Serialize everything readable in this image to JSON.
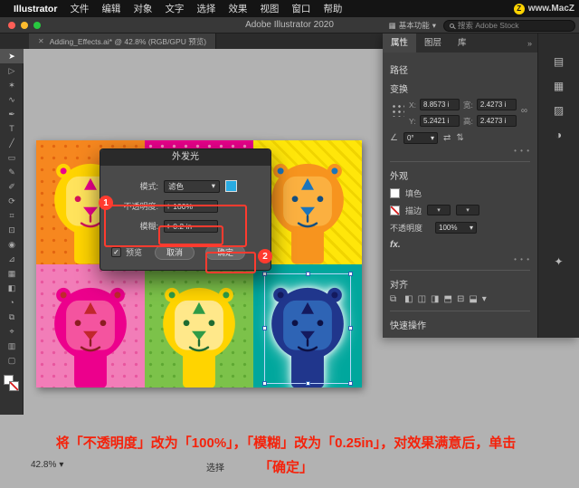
{
  "menu_bar": {
    "items": [
      "Illustrator",
      "文件",
      "编辑",
      "对象",
      "文字",
      "选择",
      "效果",
      "视图",
      "窗口",
      "帮助"
    ],
    "watermark_z": "Z",
    "watermark": "www.MacZ"
  },
  "title_bar": {
    "title": "Adobe Illustrator 2020",
    "workspace": "基本功能",
    "workspace_chevron": "▾",
    "search_placeholder": "搜索 Adobe Stock"
  },
  "document_tab": {
    "close": "✕",
    "label": "Adding_Effects.ai* @ 42.8% (RGB/GPU 预览)"
  },
  "toolbar": {
    "tools": [
      {
        "name": "selection-tool",
        "glyph": "➤",
        "active": true
      },
      {
        "name": "direct-selection-tool",
        "glyph": "▷"
      },
      {
        "name": "magic-wand-tool",
        "glyph": "✶"
      },
      {
        "name": "lasso-tool",
        "glyph": "∿"
      },
      {
        "name": "pen-tool",
        "glyph": "✒"
      },
      {
        "name": "type-tool",
        "glyph": "T"
      },
      {
        "name": "line-segment-tool",
        "glyph": "╱"
      },
      {
        "name": "rectangle-tool",
        "glyph": "▭"
      },
      {
        "name": "paintbrush-tool",
        "glyph": "✎"
      },
      {
        "name": "pencil-tool",
        "glyph": "✐"
      },
      {
        "name": "rotate-tool",
        "glyph": "⟳"
      },
      {
        "name": "width-tool",
        "glyph": "⌗"
      },
      {
        "name": "free-transform-tool",
        "glyph": "⊡"
      },
      {
        "name": "shape-builder-tool",
        "glyph": "◉"
      },
      {
        "name": "perspective-grid-tool",
        "glyph": "⊿"
      },
      {
        "name": "mesh-tool",
        "glyph": "▦"
      },
      {
        "name": "gradient-tool",
        "glyph": "◧"
      },
      {
        "name": "eyedropper-tool",
        "glyph": "◔"
      },
      {
        "name": "blend-tool",
        "glyph": "⧉"
      },
      {
        "name": "symbol-sprayer-tool",
        "glyph": "⌖"
      },
      {
        "name": "column-graph-tool",
        "glyph": "▥"
      },
      {
        "name": "artboard-tool",
        "glyph": "▢"
      }
    ]
  },
  "dialog": {
    "title": "外发光",
    "mode_label": "模式:",
    "mode_value": "滤色",
    "opacity_label": "不透明度:",
    "opacity_value": "100%",
    "blur_label": "模糊:",
    "blur_value": "0.2 in",
    "preview_label": "预览",
    "cancel_label": "取消",
    "ok_label": "确定",
    "badge_1": "1",
    "badge_2": "2",
    "check_glyph": "✓",
    "swatch_color": "#29abe2",
    "highlight_color": "#ff3b2f"
  },
  "properties": {
    "tabs": [
      "属性",
      "图层",
      "库"
    ],
    "collapse_icon": "»",
    "path_label": "路径",
    "more": "• • •",
    "transform": {
      "label": "变换",
      "x_label": "X:",
      "x_value": "8.8573 i",
      "y_label": "Y:",
      "y_value": "5.2421 i",
      "w_label": "宽:",
      "w_value": "2.4273 i",
      "h_label": "高:",
      "h_value": "2.4273 i",
      "angle_value": "0°"
    },
    "appearance": {
      "label": "外观",
      "fill_label": "填色",
      "stroke_label": "描边",
      "opacity_label": "不透明度",
      "opacity_value": "100%",
      "fx_label": "fx."
    },
    "align": {
      "label": "对齐",
      "icons": [
        {
          "name": "align-to-selection-icon",
          "glyph": "⧉"
        },
        {
          "name": "align-left-icon",
          "glyph": "◧"
        },
        {
          "name": "align-center-horizontal-icon",
          "glyph": "◫"
        },
        {
          "name": "align-right-icon",
          "glyph": "◨"
        },
        {
          "name": "align-top-icon",
          "glyph": "⬒"
        },
        {
          "name": "align-center-vertical-icon",
          "glyph": "⊟"
        },
        {
          "name": "align-bottom-icon",
          "glyph": "⬓"
        },
        {
          "name": "more-align-options-icon",
          "glyph": "▾"
        }
      ]
    },
    "quick_actions_label": "快速操作"
  },
  "panel_strip": {
    "icons": [
      {
        "name": "libraries-panel-icon",
        "glyph": "▤"
      },
      {
        "name": "swatches-panel-icon",
        "glyph": "▦"
      },
      {
        "name": "brushes-panel-icon",
        "glyph": "▨"
      },
      {
        "name": "color-panel-icon",
        "glyph": "◑"
      },
      {
        "name": "symbols-panel-icon",
        "glyph": "✦"
      }
    ]
  },
  "status_bar": {
    "zoom": "42.8%",
    "tool": "选择"
  },
  "annotation": {
    "line1": "将「不透明度」改为「100%」，「模糊」改为「0.25in」，对效果满意后，单击",
    "line2": "「确定」",
    "color": "#f5220b"
  },
  "artboard": {
    "panels": [
      {
        "bg": "#f6871f",
        "pattern": "dots",
        "pattern_color": "#e2640f",
        "mane": "#ffd400",
        "face": "#ffe35c",
        "feature": "#ec008c",
        "accent": "#d4145a",
        "body": "#ffd400"
      },
      {
        "bg": "#e8008b",
        "pattern": "dots",
        "pattern_color": "#f48fc1",
        "mane": "#d7df23",
        "face": "#e7ef6a",
        "feature": "#00a79d",
        "accent": "#006c63",
        "body": "#d7df23"
      },
      {
        "bg": "#ffe60a",
        "pattern": "stripes",
        "pattern_color": "#f0d400",
        "mane": "#f7941e",
        "face": "#fbb040",
        "feature": "#1b75bc",
        "accent": "#144f80",
        "body": "#f7941e"
      },
      {
        "bg": "#f27db8",
        "pattern": "dots",
        "pattern_color": "#e8559e",
        "mane": "#ec008c",
        "face": "#f4549f",
        "feature": "#c1272d",
        "accent": "#8c1d22",
        "body": "#ec008c"
      },
      {
        "bg": "#7cc24a",
        "pattern": "dots",
        "pattern_color": "#5ea832",
        "mane": "#ffd400",
        "face": "#ffe88a",
        "feature": "#2e9b47",
        "accent": "#1f6b31",
        "body": "#ffd400"
      },
      {
        "bg": "#00a79d",
        "pattern": "none",
        "pattern_color": "",
        "mane": "#20368c",
        "face": "#2e64b5",
        "feature": "#141a5e",
        "accent": "#0d1145",
        "body": "#20368c",
        "selected": true
      }
    ]
  }
}
